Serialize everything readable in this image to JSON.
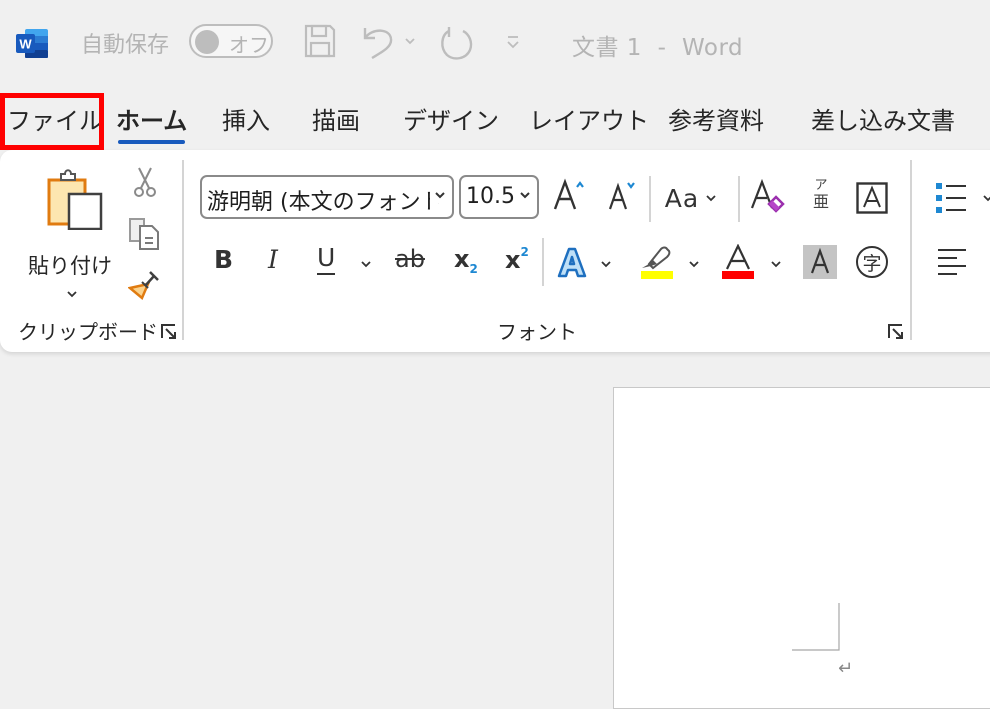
{
  "titlebar": {
    "app_icon": "word-logo-icon",
    "autosave_label": "自動保存",
    "autosave_toggle": {
      "state": "off",
      "label": "オフ"
    },
    "quick_access": [
      {
        "name": "save-icon"
      },
      {
        "name": "undo-icon"
      },
      {
        "name": "undo-dropdown-icon"
      },
      {
        "name": "redo-icon"
      },
      {
        "name": "customize-qat-icon"
      }
    ],
    "document_title": "文書 1  -  Word"
  },
  "tabs": [
    {
      "label": "ファイル",
      "highlighted": true,
      "active": false
    },
    {
      "label": "ホーム",
      "active": true
    },
    {
      "label": "挿入",
      "active": false
    },
    {
      "label": "描画",
      "active": false
    },
    {
      "label": "デザイン",
      "active": false
    },
    {
      "label": "レイアウト",
      "active": false
    },
    {
      "label": "参考資料",
      "active": false
    },
    {
      "label": "差し込み文書",
      "active": false
    }
  ],
  "highlight_color": "#ff0000",
  "accent_color": "#185abd",
  "ribbon": {
    "clipboard": {
      "label": "クリップボード",
      "paste_label": "貼り付け",
      "buttons": [
        "cut-icon",
        "copy-icon",
        "format-painter-icon"
      ]
    },
    "font": {
      "label": "フォント",
      "font_name": "游明朝 (本文のフォント",
      "font_size": "10.5",
      "row1": [
        "grow-font-icon",
        "shrink-font-icon",
        "change-case-icon",
        "clear-formatting-icon",
        "phonetic-guide-icon",
        "character-border-icon"
      ],
      "change_case_glyph": "Aa",
      "phonetic_top": "ア",
      "phonetic_bottom": "亜",
      "row2": [
        "bold-icon",
        "italic-icon",
        "underline-icon",
        "strikethrough-icon",
        "subscript-icon",
        "superscript-icon",
        "text-effects-icon",
        "highlight-icon",
        "font-color-icon",
        "character-shading-icon",
        "enclose-characters-icon"
      ],
      "bold_glyph": "B",
      "italic_glyph": "I",
      "underline_glyph": "U",
      "strike_glyph": "ab",
      "sub_glyph": "x",
      "sub_index": "2",
      "enclose_glyph": "字",
      "highlight_color": "#ffff00",
      "font_color": "#ff0000"
    },
    "paragraph": {
      "buttons": [
        "bullets-icon",
        "align-left-icon"
      ]
    }
  },
  "document": {
    "paragraph_mark": "↵"
  }
}
